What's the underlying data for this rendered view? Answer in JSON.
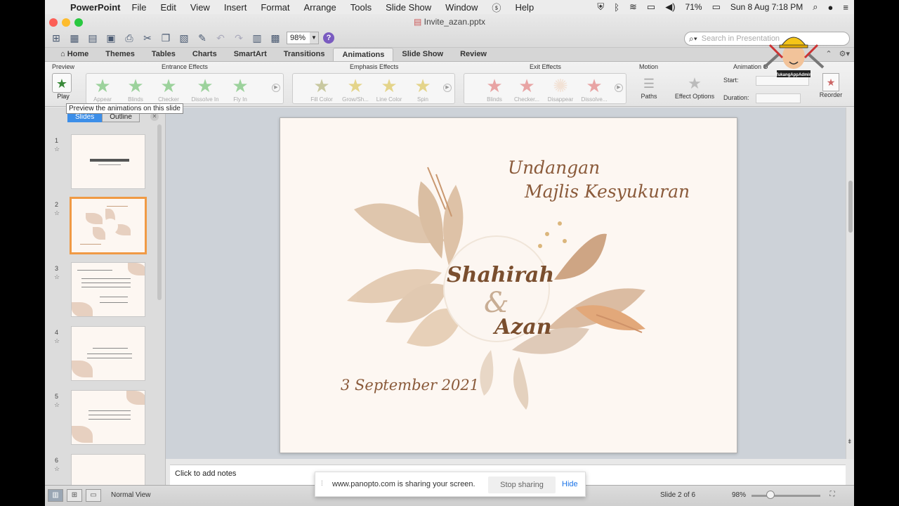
{
  "menubar": {
    "app": "PowerPoint",
    "items": [
      "File",
      "Edit",
      "View",
      "Insert",
      "Format",
      "Arrange",
      "Tools",
      "Slide Show",
      "Window",
      "Help"
    ],
    "battery": "71%",
    "clock": "Sun 8 Aug  7:18 PM"
  },
  "window": {
    "title": "Invite_azan.pptx",
    "zoom": "98%",
    "search_placeholder": "Search in Presentation"
  },
  "tabs": [
    "Home",
    "Themes",
    "Tables",
    "Charts",
    "SmartArt",
    "Transitions",
    "Animations",
    "Slide Show",
    "Review"
  ],
  "active_tab": "Animations",
  "ribbon": {
    "preview_label": "Preview",
    "play_label": "Play",
    "entrance_label": "Entrance Effects",
    "entrance": [
      "Appear",
      "Blinds",
      "Checker",
      "Dissolve In",
      "Fly In"
    ],
    "emphasis_label": "Emphasis Effects",
    "emphasis": [
      "Fill Color",
      "Grow/Sh...",
      "Line Color",
      "Spin"
    ],
    "exit_label": "Exit Effects",
    "exit": [
      "Blinds",
      "Checker...",
      "Disappear",
      "Dissolve..."
    ],
    "motion_label": "Motion",
    "paths_label": "Paths",
    "effect_options_label": "Effect Options",
    "animation_options_label": "Animation O",
    "start_label": "Start:",
    "duration_label": "Duration:",
    "reorder_label": "Reorder"
  },
  "tooltip": "Preview the animations on this slide",
  "panel": {
    "tab_slides": "Slides",
    "tab_outline": "Outline",
    "slide_numbers": [
      "1",
      "2",
      "3",
      "4",
      "5",
      "6"
    ],
    "selected": 2
  },
  "slide": {
    "heading1": "Undangan",
    "heading2": "Majlis Kesyukuran",
    "name1": "Shahirah",
    "amp": "&",
    "name2": "Azan",
    "date": "3 September 2021"
  },
  "mascot_text": "TukangAppAdmin",
  "notes_placeholder": "Click to add notes",
  "status": {
    "view": "Normal View",
    "slide_pos": "Slide 2 of 6",
    "zoom": "98%"
  },
  "share_banner": {
    "message": "www.panopto.com is sharing your screen.",
    "stop": "Stop sharing",
    "hide": "Hide"
  },
  "colors": {
    "accent_tab": "#ededed",
    "selected_thumb": "#f09a45",
    "slide_bg": "#fdf7f2",
    "script_text": "#8a5a3a"
  }
}
